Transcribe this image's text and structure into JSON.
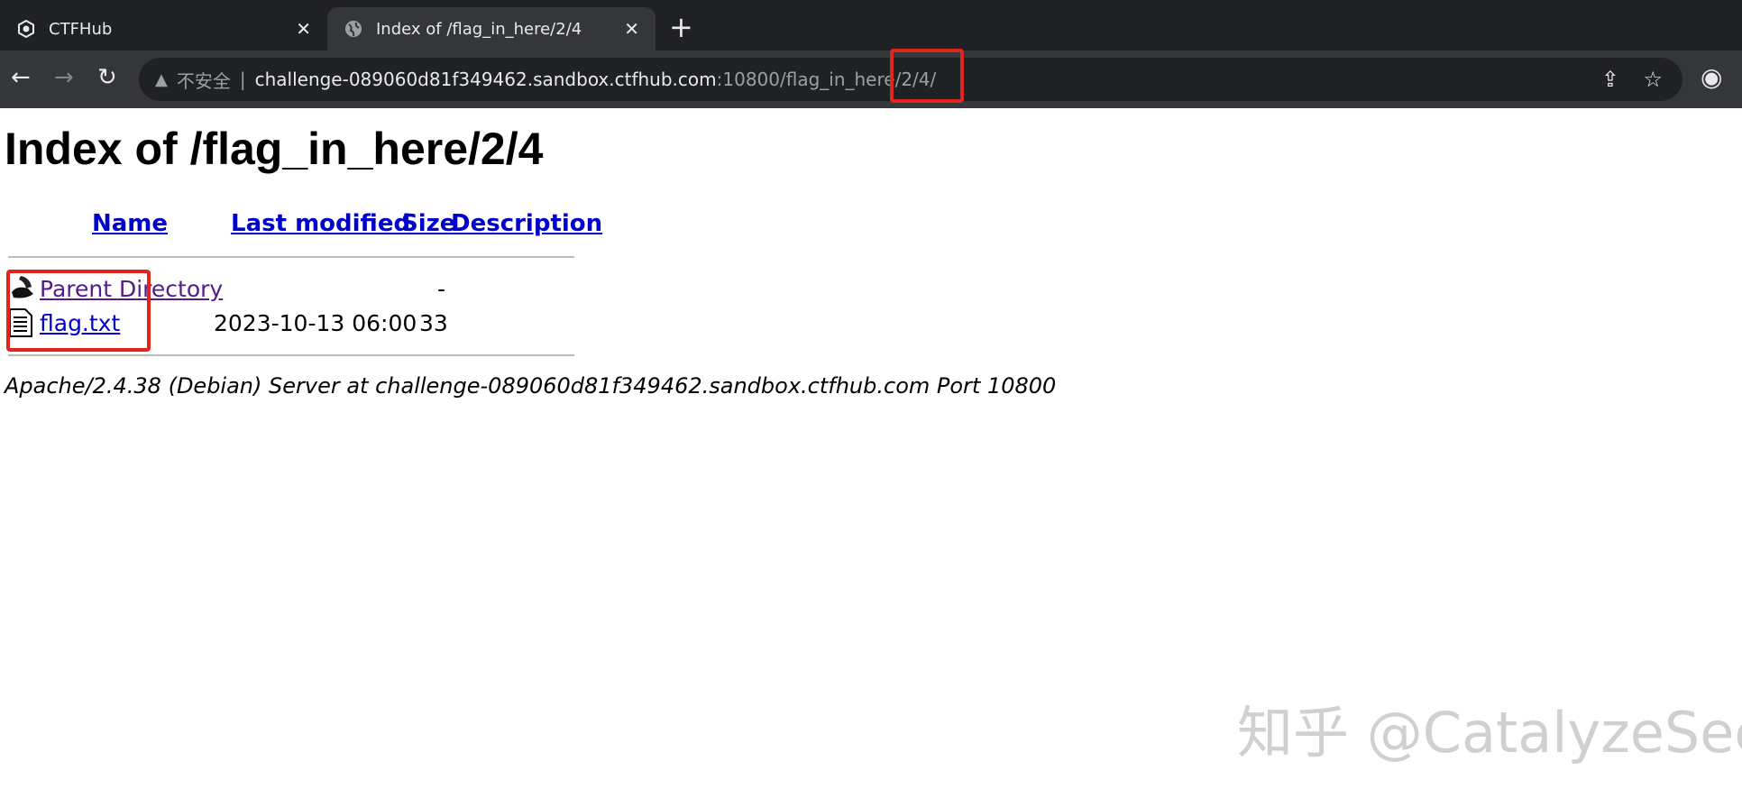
{
  "browser": {
    "tabs": [
      {
        "title": "CTFHub",
        "icon": "ctfhub-logo-icon"
      },
      {
        "title": "Index of /flag_in_here/2/4",
        "icon": "globe-icon",
        "active": true
      }
    ],
    "address": {
      "security_label": "不安全",
      "host": "challenge-089060d81f349462.sandbox.ctfhub.com",
      "rest": ":10800/flag_in_here/2/4/"
    }
  },
  "page": {
    "title": "Index of /flag_in_here/2/4",
    "columns": [
      "Name",
      "Last modified",
      "Size",
      "Description"
    ],
    "rows": [
      {
        "name": "Parent Directory",
        "modified": "",
        "size": "-",
        "icon": "back-folder-icon"
      },
      {
        "name": "flag.txt",
        "modified": "2023-10-13 06:00",
        "size": "33",
        "icon": "text-file-icon"
      }
    ],
    "footer": "Apache/2.4.38 (Debian) Server at challenge-089060d81f349462.sandbox.ctfhub.com Port 10800"
  },
  "watermark": "知乎 @CatalyzeSec",
  "colors": {
    "highlight": "#e0251c",
    "link": "#0000cc",
    "visited": "#551a8b"
  }
}
